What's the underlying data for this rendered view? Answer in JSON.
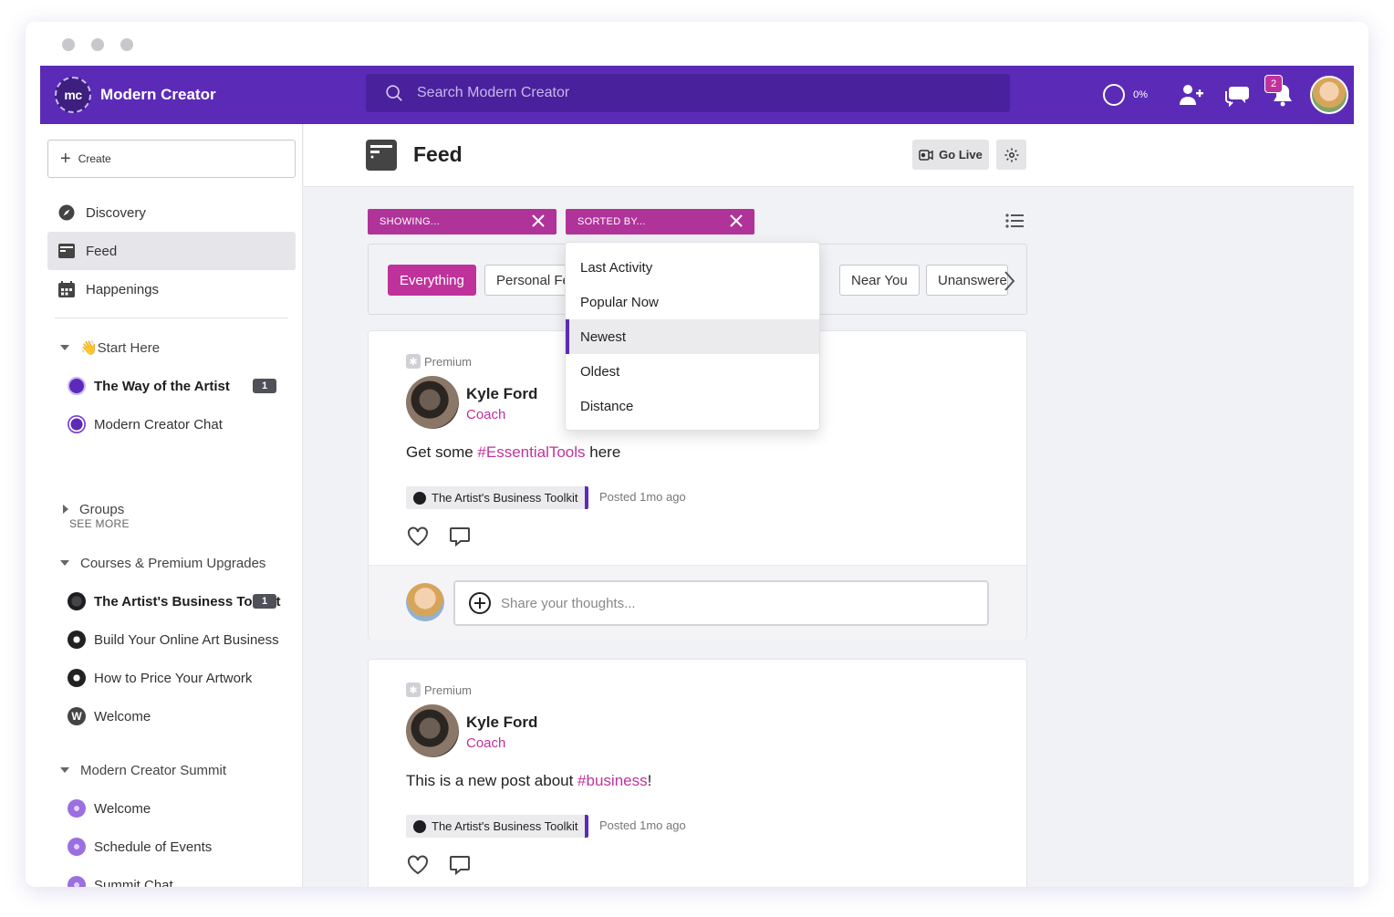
{
  "brand": {
    "name": "Modern Creator",
    "logo_text": "mc"
  },
  "search": {
    "placeholder": "Search Modern Creator"
  },
  "topbar": {
    "progress": "0%",
    "notification_count": "2"
  },
  "sidebar": {
    "create_label": "Create",
    "nav": [
      {
        "label": "Discovery",
        "icon": "compass-icon"
      },
      {
        "label": "Feed",
        "icon": "feed-icon"
      },
      {
        "label": "Happenings",
        "icon": "calendar-icon"
      }
    ],
    "start_here": {
      "title": "👋Start Here",
      "items": [
        {
          "label": "The Way of the Artist",
          "count": "1"
        },
        {
          "label": "Modern Creator Chat"
        }
      ],
      "see_more": "SEE MORE"
    },
    "groups": {
      "title": "Groups"
    },
    "courses": {
      "title": "Courses & Premium Upgrades",
      "items": [
        {
          "label": "The Artist's Business Toolkit",
          "count": "1"
        },
        {
          "label": "Build Your Online Art Business"
        },
        {
          "label": "How to Price Your Artwork"
        },
        {
          "label": "Welcome"
        }
      ]
    },
    "summit": {
      "title": "Modern Creator Summit",
      "items": [
        {
          "label": "Welcome"
        },
        {
          "label": "Schedule of Events"
        },
        {
          "label": "Summit Chat"
        }
      ]
    }
  },
  "page": {
    "title": "Feed",
    "go_live": "Go Live"
  },
  "filters": {
    "showing_label": "SHOWING...",
    "sorted_label": "SORTED BY...",
    "pills": [
      "Everything",
      "Personal Feed",
      "Near You",
      "Unanswered"
    ]
  },
  "sort_menu": {
    "options": [
      "Last Activity",
      "Popular Now",
      "Newest",
      "Oldest",
      "Distance"
    ],
    "selected": "Newest"
  },
  "posts": [
    {
      "badge": "Premium",
      "author": "Kyle Ford",
      "role": "Coach",
      "text_before": "Get some ",
      "hashtag": "#EssentialTools",
      "text_after": " here",
      "space": "The Artist's Business Toolkit",
      "posted": "Posted 1mo ago",
      "comment_placeholder": "Share your thoughts..."
    },
    {
      "badge": "Premium",
      "author": "Kyle Ford",
      "role": "Coach",
      "text_before": "This is a new post about ",
      "hashtag": "#business",
      "text_after": "!",
      "space": "The Artist's Business Toolkit",
      "posted": "Posted 1mo ago"
    }
  ],
  "colors": {
    "brand_purple": "#5b2bb8",
    "accent_magenta": "#c0329b"
  }
}
